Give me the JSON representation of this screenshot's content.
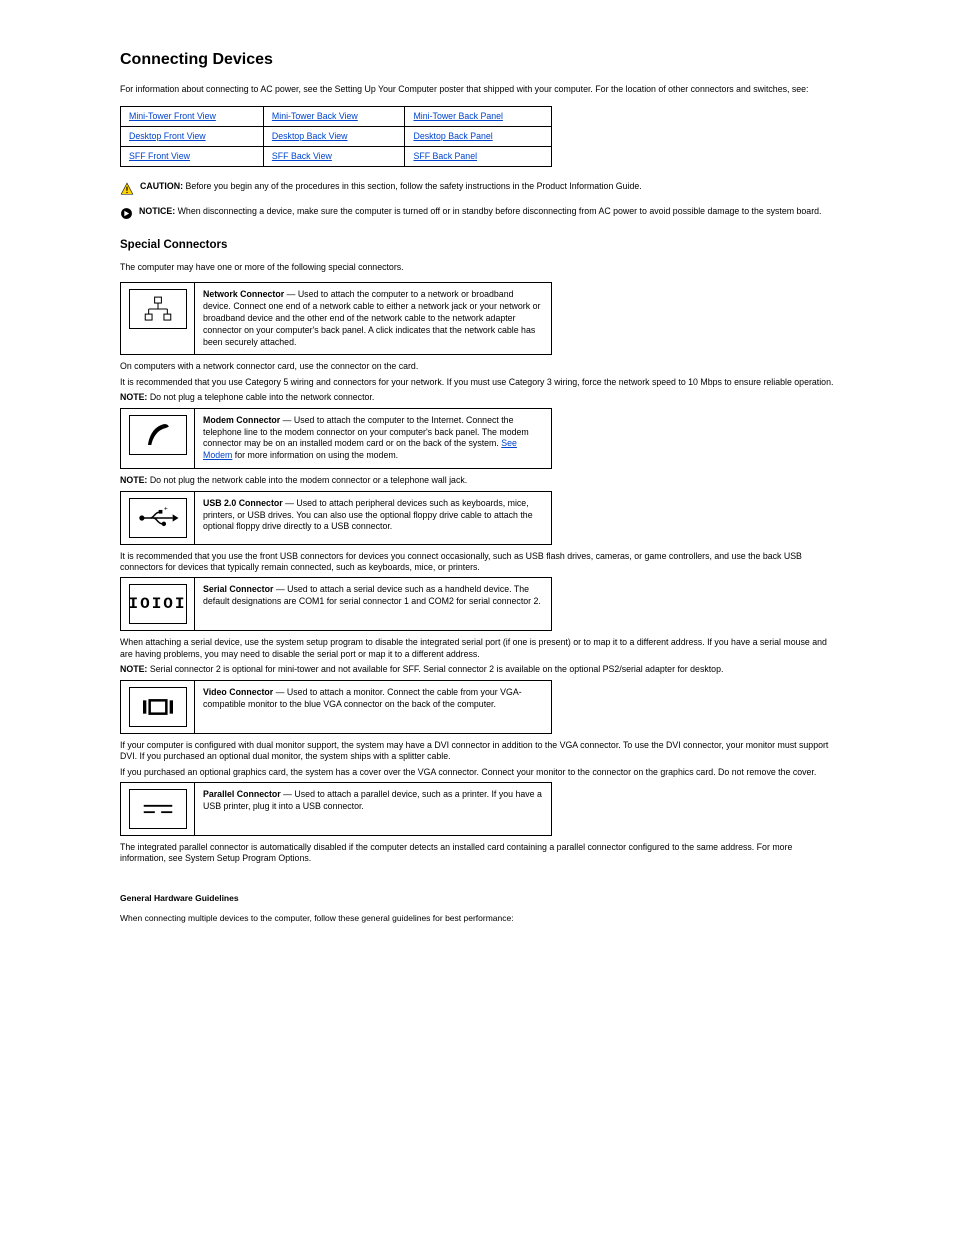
{
  "section_title": "Connecting Devices",
  "intro": "For information about connecting to AC power, see the Setting Up Your Computer poster that shipped with your computer. For the location of other connectors and switches, see:",
  "links": {
    "r0": [
      "Mini-Tower Front View",
      "Mini-Tower Back View",
      "Mini-Tower Back Panel"
    ],
    "r1": [
      "Desktop Front View",
      "Desktop Back View",
      "Desktop Back Panel"
    ],
    "r2": [
      "SFF Front View",
      "SFF Back View",
      "SFF Back Panel"
    ]
  },
  "caution": {
    "label": "CAUTION:",
    "body": "Before you begin any of the procedures in this section, follow the safety instructions in the Product Information Guide."
  },
  "notice": {
    "label": "NOTICE:",
    "body": "When disconnecting a device, make sure the computer is turned off or in standby before disconnecting from AC power to avoid possible damage to the system board."
  },
  "connectors": {
    "heading": "Special Connectors",
    "intro": "The computer may have one or more of the following special connectors.",
    "network": {
      "title": "Network Connector",
      "body": "Used to attach the computer to a network or broadband device. Connect one end of a network cable to either a network jack or your network or broadband device and the other end of the network cable to the network adapter connector on your computer's back panel. A click indicates that the network cable has been securely attached.",
      "caption1": "On computers with a network connector card, use the connector on the card.",
      "caption2": "It is recommended that you use Category 5 wiring and connectors for your network. If you must use Category 3 wiring, force the network speed to 10 Mbps to ensure reliable operation.",
      "note_label": "NOTE:",
      "note_body": "Do not plug a telephone cable into the network connector."
    },
    "modem": {
      "title": "Modem Connector",
      "body_pre": "Used to attach the computer to the Internet. Connect the telephone line to the modem connector on your computer's back panel. The modem connector may be on an installed modem card or on the back of the system.",
      "body_post": " for more information on using the modem.",
      "link": "See Modem",
      "note_label": "NOTE:",
      "note_body": "Do not plug the network cable into the modem connector or a telephone wall jack."
    },
    "usb": {
      "title": "USB 2.0 Connector",
      "body": "Used to attach peripheral devices such as keyboards, mice, printers, or USB drives. You can also use the optional floppy drive cable to attach the optional floppy drive directly to a USB connector.",
      "caption": "It is recommended that you use the front USB connectors for devices you connect occasionally, such as USB flash drives, cameras, or game controllers, and use the back USB connectors for devices that typically remain connected, such as keyboards, mice, or printers."
    },
    "serial": {
      "title": "Serial Connector",
      "body": "Used to attach a serial device such as a handheld device. The default designations are COM1 for serial connector 1 and COM2 for serial connector 2.",
      "caption": "When attaching a serial device, use the system setup program to disable the integrated serial port (if one is present) or to map it to a different address. If you have a serial mouse and are having problems, you may need to disable the serial port or map it to a different address.",
      "note_label": "NOTE:",
      "note_body": "Serial connector 2 is optional for mini-tower and not available for SFF. Serial connector 2 is available on the optional PS2/serial adapter for desktop."
    },
    "video": {
      "title": "Video Connector",
      "body": "Used to attach a monitor. Connect the cable from your VGA-compatible monitor to the blue VGA connector on the back of the computer.",
      "caption1": "If your computer is configured with dual monitor support, the system may have a DVI connector in addition to the VGA connector. To use the DVI connector, your monitor must support DVI. If you purchased an optional dual monitor, the system ships with a splitter cable.",
      "caption2": "If you purchased an optional graphics card, the system has a cover over the VGA connector. Connect your monitor to the connector on the graphics card. Do not remove the cover."
    },
    "parallel": {
      "title": "Parallel Connector",
      "body": "Used to attach a parallel device, such as a printer. If you have a USB printer, plug it into a USB connector.",
      "caption": "The integrated parallel connector is automatically disabled if the computer detects an installed card containing a parallel connector configured to the same address. For more information, see System Setup Program Options."
    }
  },
  "footer": {
    "general": "General Hardware Guidelines",
    "body": "When connecting multiple devices to the computer, follow these general guidelines for best performance:"
  }
}
